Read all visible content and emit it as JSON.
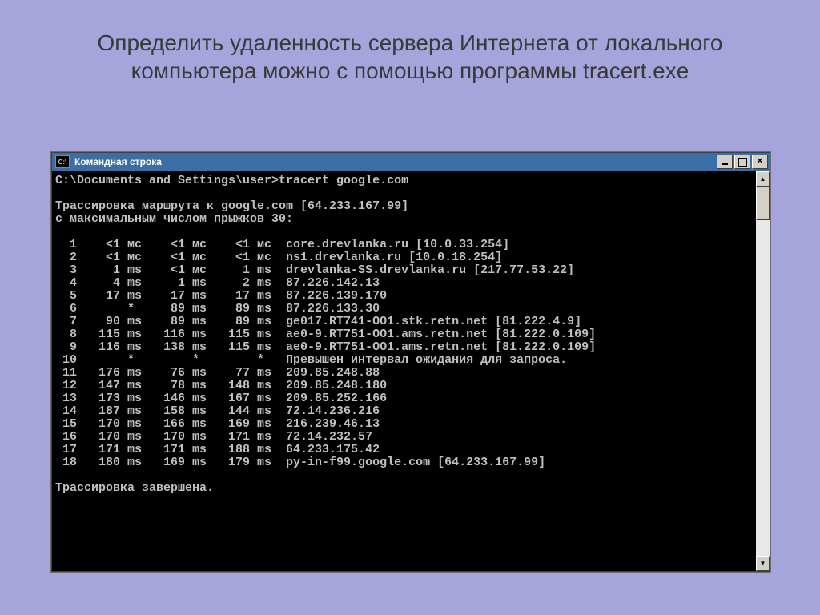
{
  "heading": "Определить удаленность сервера Интернета от локального компьютера можно с помощью программы tracert.exe",
  "window": {
    "sys_icon_label": "C:\\",
    "title": "Командная строка"
  },
  "console": {
    "prompt_line": "C:\\Documents and Settings\\user>tracert google.com",
    "route_line_1": "Трассировка маршрута к google.com [64.233.167.99]",
    "route_line_2": "с максимальным числом прыжков 30:",
    "hops": [
      {
        "n": 1,
        "t1": "<1 мс",
        "t2": "<1 мс",
        "t3": "<1 мс",
        "host": "core.drevlanka.ru [10.0.33.254]"
      },
      {
        "n": 2,
        "t1": "<1 мс",
        "t2": "<1 мс",
        "t3": "<1 мс",
        "host": "ns1.drevlanka.ru [10.0.18.254]"
      },
      {
        "n": 3,
        "t1": " 1 ms",
        "t2": "<1 мс",
        "t3": " 1 ms",
        "host": "drevlanka-SS.drevlanka.ru [217.77.53.22]"
      },
      {
        "n": 4,
        "t1": " 4 ms",
        "t2": " 1 ms",
        "t3": " 2 ms",
        "host": "87.226.142.13"
      },
      {
        "n": 5,
        "t1": "17 ms",
        "t2": "17 ms",
        "t3": "17 ms",
        "host": "87.226.139.170"
      },
      {
        "n": 6,
        "t1": "   * ",
        "t2": "89 ms",
        "t3": "89 ms",
        "host": "87.226.133.30"
      },
      {
        "n": 7,
        "t1": "90 ms",
        "t2": "89 ms",
        "t3": "89 ms",
        "host": "ge017.RT741-OO1.stk.retn.net [81.222.4.9]"
      },
      {
        "n": 8,
        "t1": "115 ms",
        "t2": "116 ms",
        "t3": "115 ms",
        "host": "ae0-9.RT751-OO1.ams.retn.net [81.222.0.109]"
      },
      {
        "n": 9,
        "t1": "116 ms",
        "t2": "138 ms",
        "t3": "115 ms",
        "host": "ae0-9.RT751-OO1.ams.retn.net [81.222.0.109]"
      },
      {
        "n": 10,
        "t1": "    * ",
        "t2": "    * ",
        "t3": "    * ",
        "host": "Превышен интервал ожидания для запроса."
      },
      {
        "n": 11,
        "t1": "176 ms",
        "t2": "76 ms",
        "t3": "77 ms",
        "host": "209.85.248.88"
      },
      {
        "n": 12,
        "t1": "147 ms",
        "t2": "78 ms",
        "t3": "148 ms",
        "host": "209.85.248.180"
      },
      {
        "n": 13,
        "t1": "173 ms",
        "t2": "146 ms",
        "t3": "167 ms",
        "host": "209.85.252.166"
      },
      {
        "n": 14,
        "t1": "187 ms",
        "t2": "158 ms",
        "t3": "144 ms",
        "host": "72.14.236.216"
      },
      {
        "n": 15,
        "t1": "170 ms",
        "t2": "166 ms",
        "t3": "169 ms",
        "host": "216.239.46.13"
      },
      {
        "n": 16,
        "t1": "170 ms",
        "t2": "170 ms",
        "t3": "171 ms",
        "host": "72.14.232.57"
      },
      {
        "n": 17,
        "t1": "171 ms",
        "t2": "171 ms",
        "t3": "188 ms",
        "host": "64.233.175.42"
      },
      {
        "n": 18,
        "t1": "180 ms",
        "t2": "169 ms",
        "t3": "179 ms",
        "host": "py-in-f99.google.com [64.233.167.99]"
      }
    ],
    "end_line": "Трассировка завершена."
  }
}
